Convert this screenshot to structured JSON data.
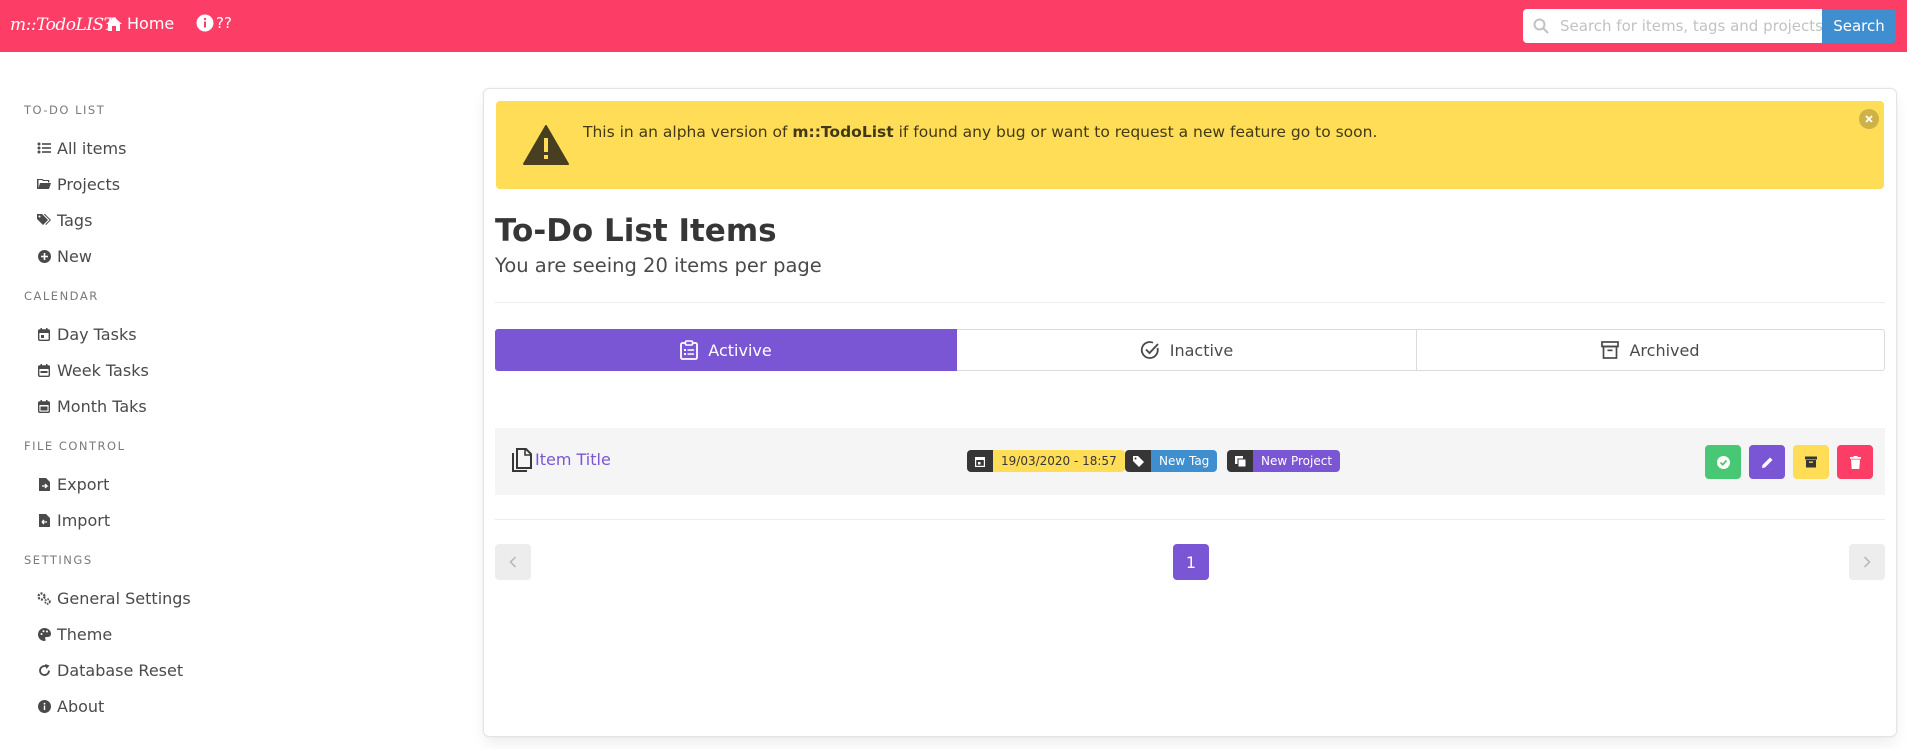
{
  "navbar": {
    "brand": "m::TodoLIST",
    "home_label": "Home",
    "info_label": "??",
    "search_placeholder": "Search for items, tags and projects",
    "search_button": "Search"
  },
  "sidebar": {
    "sections": [
      {
        "label": "TO-DO LIST",
        "items": [
          {
            "label": "All items",
            "icon": "list-icon"
          },
          {
            "label": "Projects",
            "icon": "folder-icon"
          },
          {
            "label": "Tags",
            "icon": "tags-icon"
          },
          {
            "label": "New",
            "icon": "plus-circle-icon"
          }
        ]
      },
      {
        "label": "CALENDAR",
        "items": [
          {
            "label": "Day Tasks",
            "icon": "calendar-day-icon"
          },
          {
            "label": "Week Tasks",
            "icon": "calendar-week-icon"
          },
          {
            "label": "Month Taks",
            "icon": "calendar-icon"
          }
        ]
      },
      {
        "label": "FILE CONTROL",
        "items": [
          {
            "label": "Export",
            "icon": "file-export-icon"
          },
          {
            "label": "Import",
            "icon": "file-import-icon"
          }
        ]
      },
      {
        "label": "SETTINGS",
        "items": [
          {
            "label": "General Settings",
            "icon": "cogs-icon"
          },
          {
            "label": "Theme",
            "icon": "palette-icon"
          },
          {
            "label": "Database Reset",
            "icon": "redo-icon"
          },
          {
            "label": "About",
            "icon": "info-circle-icon"
          }
        ]
      }
    ]
  },
  "notice": {
    "prefix": "This in an alpha version of ",
    "app_name": "m::TodoList",
    "suffix": " if found any bug or want to request a new feature go to soon."
  },
  "main": {
    "title": "To-Do List Items",
    "subtitle": "You are seeing 20 items per page",
    "tabs": [
      {
        "label": "Activive",
        "active": true
      },
      {
        "label": "Inactive",
        "active": false
      },
      {
        "label": "Archived",
        "active": false
      }
    ],
    "items": [
      {
        "title": "Item Title",
        "date": "19/03/2020 - 18:57",
        "tag": "New Tag",
        "project": "New Project"
      }
    ],
    "pagination": {
      "current_page": "1"
    }
  },
  "colors": {
    "navbar": "#fc3d65",
    "primary": "#7a55d4",
    "info": "#3e8ed0",
    "warning": "#ffdd57",
    "success": "#48c774",
    "danger": "#fc3d65"
  }
}
